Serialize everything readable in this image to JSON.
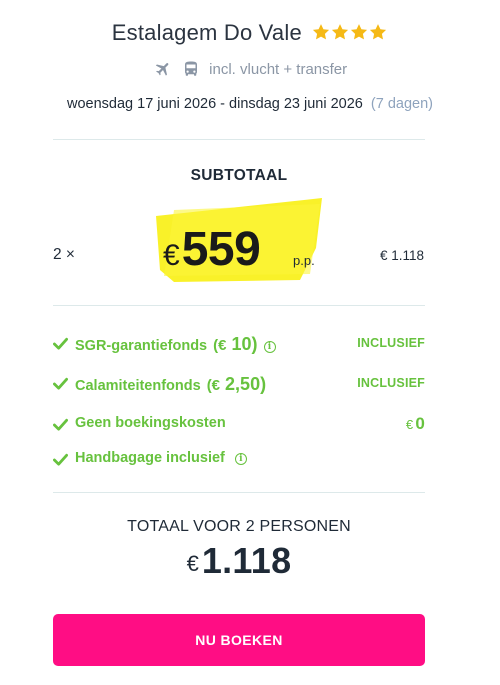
{
  "hotel": {
    "name": "Estalagem Do Vale",
    "stars": 4,
    "star_color": "#f5b916"
  },
  "transport": {
    "icons": [
      "airplane-icon",
      "bus-icon"
    ],
    "text": "incl. vlucht + transfer"
  },
  "dates": {
    "range": "woensdag 17 juni 2026 - dinsdag 23 juni 2026",
    "duration": "(7 dagen)"
  },
  "subtotal": {
    "label": "SUBTOTAAL",
    "quantity": "2 ×",
    "currency": "€",
    "price_per_person": "559",
    "pp_label": "p.p.",
    "line_total": "€ 1.118",
    "highlight_color": "#f9f01e"
  },
  "features": [
    {
      "label": "SGR-garantiefonds",
      "amount_currency": "(€",
      "amount_value": "10)",
      "has_info": true,
      "info_glyph": "i",
      "right": "INCLUSIEF"
    },
    {
      "label": "Calamiteitenfonds",
      "amount_currency": "(€",
      "amount_value": "2,50)",
      "has_info": false,
      "right": "INCLUSIEF"
    },
    {
      "label": "Geen boekingskosten",
      "right_currency": "€",
      "right_value": "0"
    },
    {
      "label": "Handbagage inclusief",
      "has_info": true,
      "info_glyph": "i"
    }
  ],
  "total": {
    "label": "TOTAAL VOOR 2 PERSONEN",
    "currency": "€",
    "value": "1.118"
  },
  "book_button": {
    "label": "NU BOEKEN",
    "color": "#ff0d84"
  },
  "colors": {
    "green": "#67c23e",
    "divider": "#dde9ea",
    "muted": "#8b96a5"
  }
}
